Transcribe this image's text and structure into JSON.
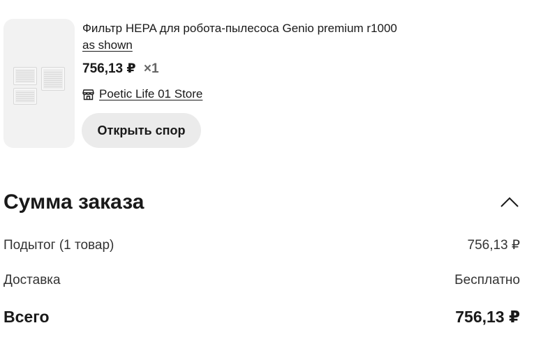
{
  "product": {
    "title": "Фильтр HEPA для робота-пылесоса Genio premium r1000",
    "variant": "as shown",
    "price": "756,13 ₽",
    "quantity": "×1",
    "store_icon": "store-icon",
    "store_name": "Poetic Life 01 Store",
    "dispute_button": "Открыть спор"
  },
  "summary": {
    "title": "Сумма заказа",
    "collapse_icon": "chevron-up-icon",
    "rows": [
      {
        "label": "Подытог (1 товар)",
        "value": "756,13 ₽"
      },
      {
        "label": "Доставка",
        "value": "Бесплатно"
      }
    ],
    "total": {
      "label": "Всего",
      "value": "756,13 ₽"
    }
  }
}
